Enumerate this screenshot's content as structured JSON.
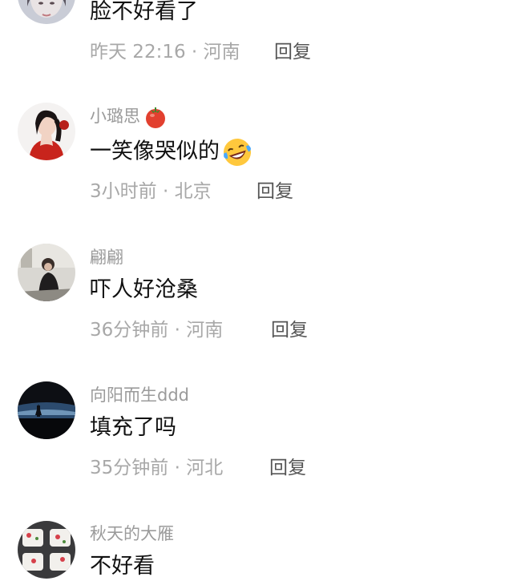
{
  "comments": [
    {
      "username": "",
      "content": "脸不好看了",
      "time": "昨天 22:16",
      "location": "河南",
      "reply_label": "回复",
      "avatar_icon": "avatar-woman-pale"
    },
    {
      "username": "小璐思",
      "badge_icon": "tomato-icon",
      "content": "一笑像哭似的",
      "content_emoji": "laughing-crying-emoji",
      "time": "3小时前",
      "location": "北京",
      "reply_label": "回复",
      "avatar_icon": "avatar-woman-red-dress"
    },
    {
      "username": "翩翩",
      "content": "吓人好沧桑",
      "time": "36分钟前",
      "location": "河南",
      "reply_label": "回复",
      "avatar_icon": "avatar-woman-seated"
    },
    {
      "username": "向阳而生ddd",
      "content": "填充了吗",
      "time": "35分钟前",
      "location": "河北",
      "reply_label": "回复",
      "avatar_icon": "avatar-night-scene"
    },
    {
      "username": "秋天的大雁",
      "content": "不好看",
      "time": "",
      "location": "",
      "reply_label": "",
      "avatar_icon": "avatar-floral-cups"
    }
  ],
  "meta_separator": "·",
  "colors": {
    "username": "#9b9b9b",
    "content": "#111111",
    "meta": "#a8a8a8",
    "reply": "#555555"
  }
}
